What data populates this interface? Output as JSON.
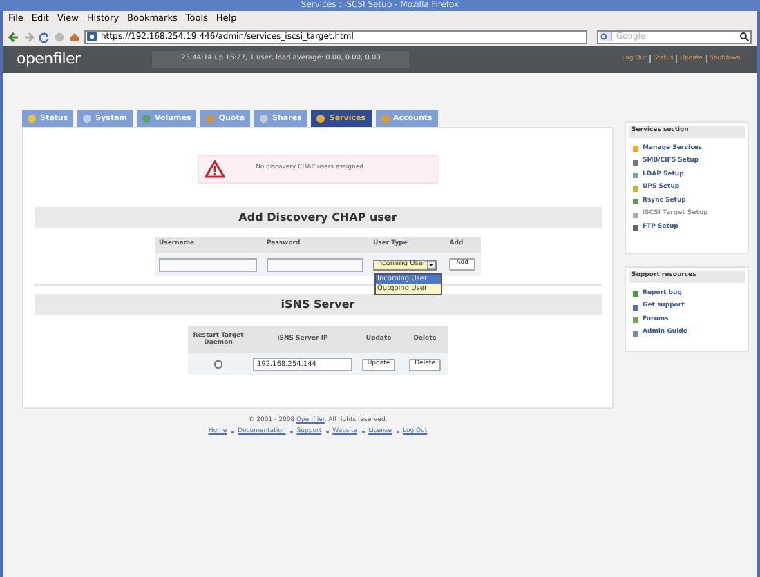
{
  "window": {
    "title": "Services : iSCSI Setup - Mozilla Firefox"
  },
  "menu": [
    "File",
    "Edit",
    "View",
    "History",
    "Bookmarks",
    "Tools",
    "Help"
  ],
  "toolbar": {
    "url": "https://192.168.254.19:446/admin/services_iscsi_target.html",
    "search_placeholder": "Google"
  },
  "header": {
    "logo": "openfiler",
    "status": "23:44:14 up 15:27, 1 user, load average: 0.00, 0.00, 0.00",
    "links": [
      "Log Out",
      "Status",
      "Update",
      "Shutdown"
    ]
  },
  "tabs": [
    {
      "label": "Status",
      "selected": false
    },
    {
      "label": "System",
      "selected": false
    },
    {
      "label": "Volumes",
      "selected": false
    },
    {
      "label": "Quota",
      "selected": false
    },
    {
      "label": "Shares",
      "selected": false
    },
    {
      "label": "Services",
      "selected": true
    },
    {
      "label": "Accounts",
      "selected": false
    }
  ],
  "notice": "No discovery CHAP users assigned.",
  "chap": {
    "title": "Add Discovery CHAP user",
    "columns": [
      "Username",
      "Password",
      "User Type",
      "Add"
    ],
    "user_type": "Incoming User",
    "add_button": "Add",
    "dropdown": [
      {
        "label": "Incoming User",
        "selected": true
      },
      {
        "label": "Outgoing User",
        "selected": false
      }
    ]
  },
  "isns": {
    "title": "iSNS Server",
    "columns": [
      "Restart Target Daemon",
      "iSNS Server IP",
      "Update",
      "Delete"
    ],
    "restart_checked": false,
    "server_ip": "192.168.254.144",
    "buttons": [
      "Update",
      "Delete"
    ]
  },
  "sidebar": [
    {
      "title": "Services section",
      "items": [
        {
          "label": "Manage Services",
          "current": false
        },
        {
          "label": "SMB/CIFS Setup",
          "current": false
        },
        {
          "label": "LDAP Setup",
          "current": false
        },
        {
          "label": "UPS Setup",
          "current": false
        },
        {
          "label": "Rsync Setup",
          "current": false
        },
        {
          "label": "iSCSI Target Setup",
          "current": true
        },
        {
          "label": "FTP Setup",
          "current": false
        }
      ]
    },
    {
      "title": "Support resources",
      "items": [
        {
          "label": "Report bug",
          "current": false
        },
        {
          "label": "Get support",
          "current": false
        },
        {
          "label": "Forums",
          "current": false
        },
        {
          "label": "Admin Guide",
          "current": false
        }
      ]
    }
  ],
  "footer": {
    "copyright_before": "© 2001 - 2008",
    "copyright_link": "Openfiler",
    "copyright_after": ". All rights reserved.",
    "links": [
      "Home",
      "Documentation",
      "Support",
      "Website",
      "License",
      "Log Out"
    ]
  }
}
